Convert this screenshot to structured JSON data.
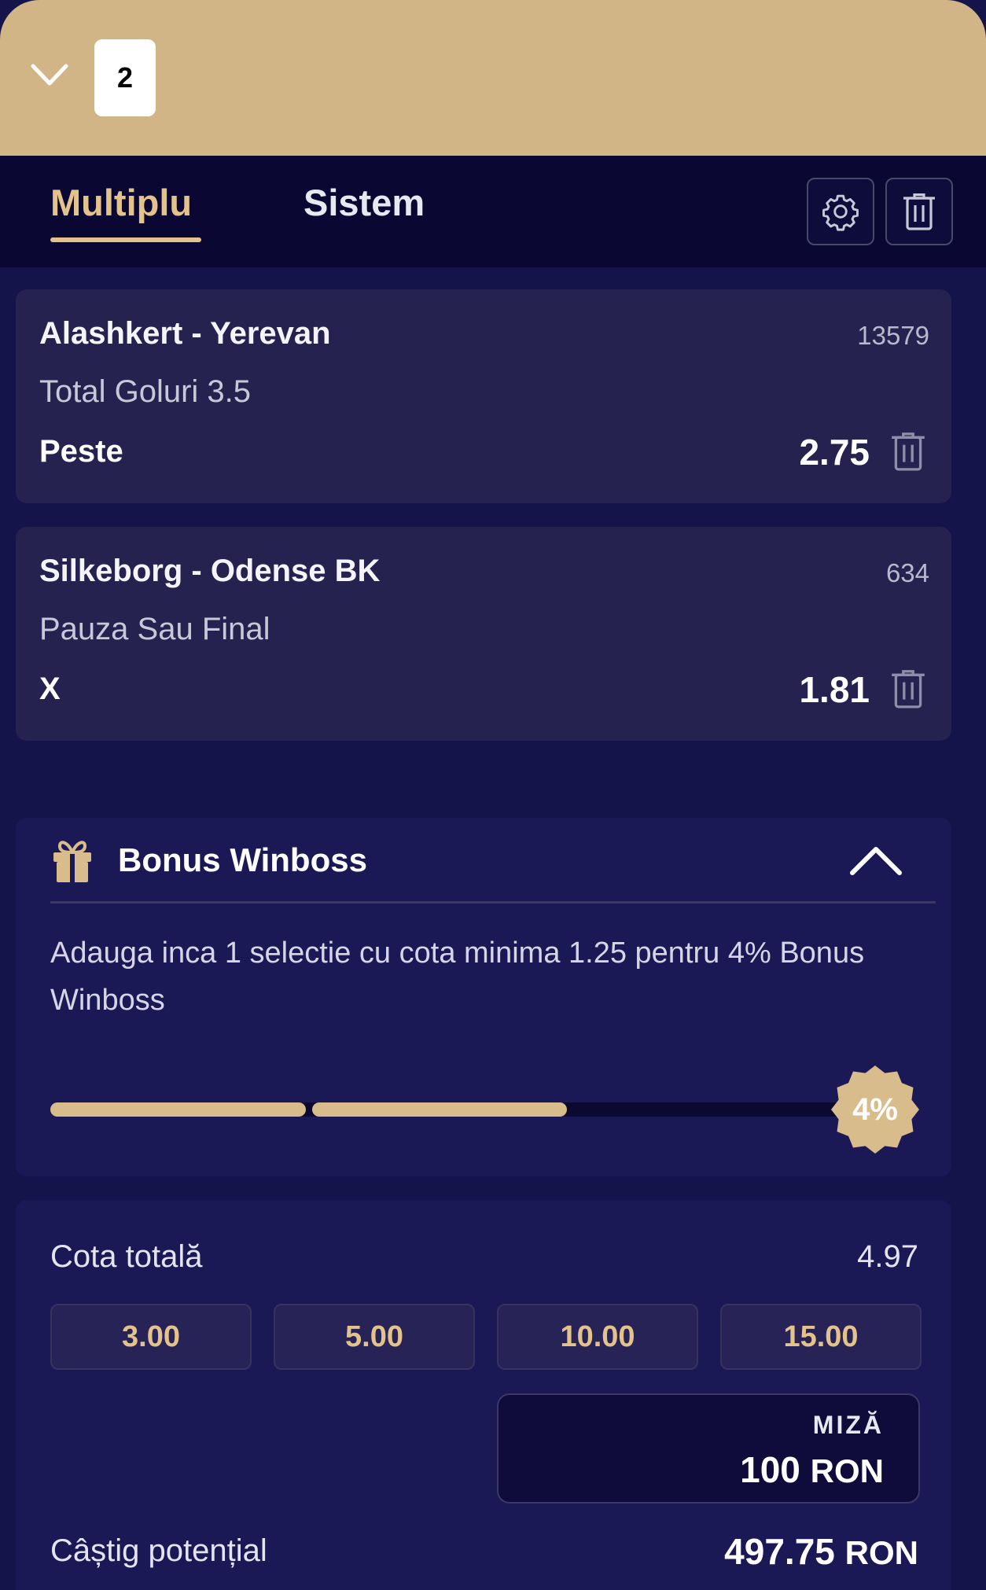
{
  "header": {
    "selection_count": "2"
  },
  "tabs": [
    {
      "label": "Multiplu",
      "active": true
    },
    {
      "label": "Sistem",
      "active": false
    }
  ],
  "icons": {
    "collapse": "chevron-down-icon",
    "settings": "gear-icon",
    "clear_all": "trash-icon"
  },
  "selections": [
    {
      "match": "Alashkert - Yerevan",
      "code": "13579",
      "market": "Total Goluri 3.5",
      "pick": "Peste",
      "odds": "2.75"
    },
    {
      "match": "Silkeborg - Odense BK",
      "code": "634",
      "market": "Pauza Sau Final",
      "pick": "X",
      "odds": "1.81"
    }
  ],
  "bonus": {
    "title": "Bonus Winboss",
    "message": "Adauga inca 1 selectie cu cota minima 1.25 pentru 4% Bonus Winboss",
    "badge": "4%",
    "progress_filled_segments": 2,
    "progress_total_segments": 3
  },
  "ticket": {
    "total_odds_label": "Cota totală",
    "total_odds_value": "4.97",
    "quick_stakes": [
      "3.00",
      "5.00",
      "10.00",
      "15.00"
    ],
    "stake_label": "MIZĂ",
    "stake_amount": "100",
    "currency": "RON",
    "potential_win_label": "Câștig potențial",
    "potential_win_value": "497.75"
  },
  "colors": {
    "header_gold": "#d1b586",
    "accent_gold": "#e3c28c",
    "background": "#14134a",
    "card": "#262250"
  }
}
